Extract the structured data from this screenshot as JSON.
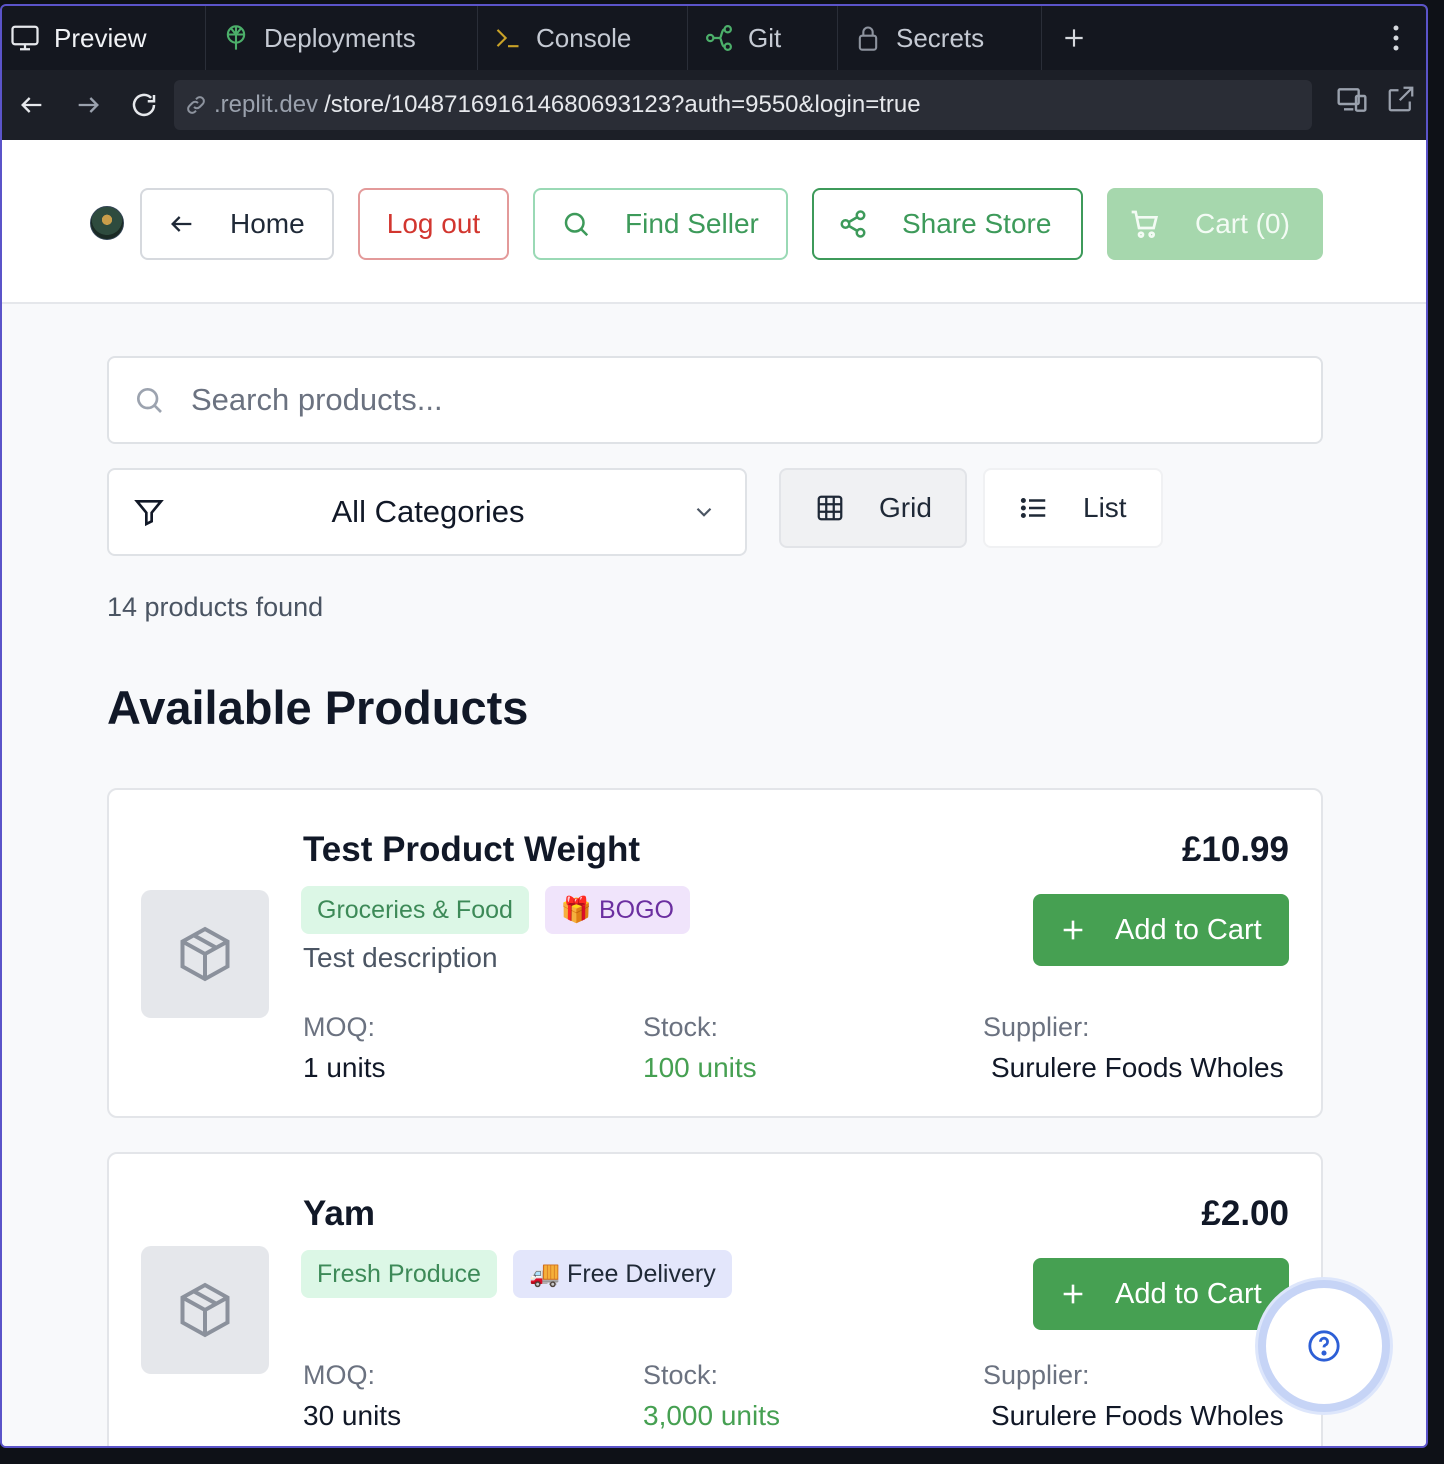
{
  "ide_tabs": {
    "preview": "Preview",
    "deployments": "Deployments",
    "console": "Console",
    "git": "Git",
    "secrets": "Secrets"
  },
  "url": {
    "host": ".replit.dev",
    "path": "/store/10487169161468069312 3?auth=9550&login=true",
    "path_full": "/store/104871691614680693123?auth=9550&login=true"
  },
  "header": {
    "home_label": "Home",
    "logout_label": "Log out",
    "find_seller_label": "Find Seller",
    "share_store_label": "Share Store",
    "cart_label": "Cart (0)"
  },
  "search": {
    "placeholder": "Search products..."
  },
  "filters": {
    "category_selected": "All Categories",
    "grid_label": "Grid",
    "list_label": "List"
  },
  "results_count": "14 products found",
  "section_title": "Available Products",
  "products": [
    {
      "name": "Test Product Weight",
      "price": "£10.99",
      "tags": [
        "Groceries & Food",
        "🎁 BOGO"
      ],
      "description": "Test description",
      "add_label": "Add to Cart",
      "moq_label": "MOQ:",
      "moq_value": "1 units",
      "stock_label": "Stock:",
      "stock_value": "100 units",
      "supplier_label": "Supplier:",
      "supplier_value": "Surulere Foods Wholes"
    },
    {
      "name": "Yam",
      "price": "£2.00",
      "tags": [
        "Fresh Produce",
        "🚚 Free Delivery"
      ],
      "description": "",
      "add_label": "Add to Cart",
      "moq_label": "MOQ:",
      "moq_value": "30 units",
      "stock_label": "Stock:",
      "stock_value": "3,000 units",
      "supplier_label": "Supplier:",
      "supplier_value": "Surulere Foods Wholes"
    }
  ],
  "colors": {
    "primary_green": "#46a052",
    "logout_red": "#d2362f",
    "cart_disabled": "#a6d7ad",
    "frame_accent": "#5b54c9"
  }
}
